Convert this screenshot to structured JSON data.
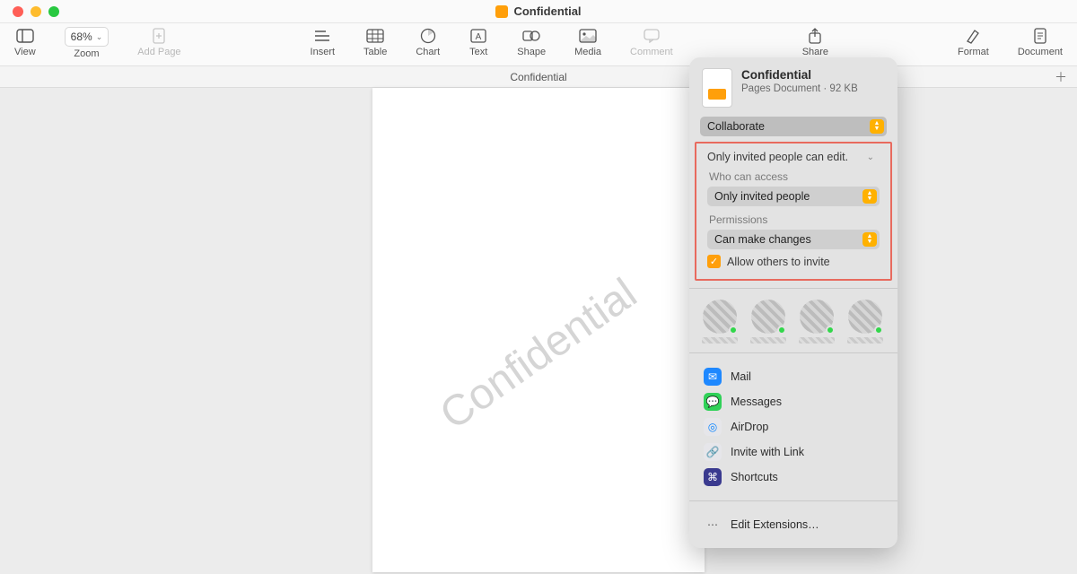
{
  "window": {
    "title": "Confidential"
  },
  "toolbar": {
    "view": "View",
    "zoom_label": "Zoom",
    "zoom_value": "68%",
    "add_page": "Add Page",
    "insert": "Insert",
    "table": "Table",
    "chart": "Chart",
    "text": "Text",
    "shape": "Shape",
    "media": "Media",
    "comment": "Comment",
    "share": "Share",
    "format": "Format",
    "document": "Document"
  },
  "tabs": {
    "current": "Confidential"
  },
  "page": {
    "watermark": "Confidential"
  },
  "share_popover": {
    "doc_name": "Confidential",
    "doc_meta": "Pages Document · 92 KB",
    "mode": "Collaborate",
    "summary": "Only invited people can edit.",
    "access_label": "Who can access",
    "access_value": "Only invited people",
    "perm_label": "Permissions",
    "perm_value": "Can make changes",
    "allow_invite": "Allow others to invite",
    "share_options": {
      "mail": "Mail",
      "messages": "Messages",
      "airdrop": "AirDrop",
      "link": "Invite with Link",
      "shortcuts": "Shortcuts",
      "edit_ext": "Edit Extensions…"
    }
  }
}
